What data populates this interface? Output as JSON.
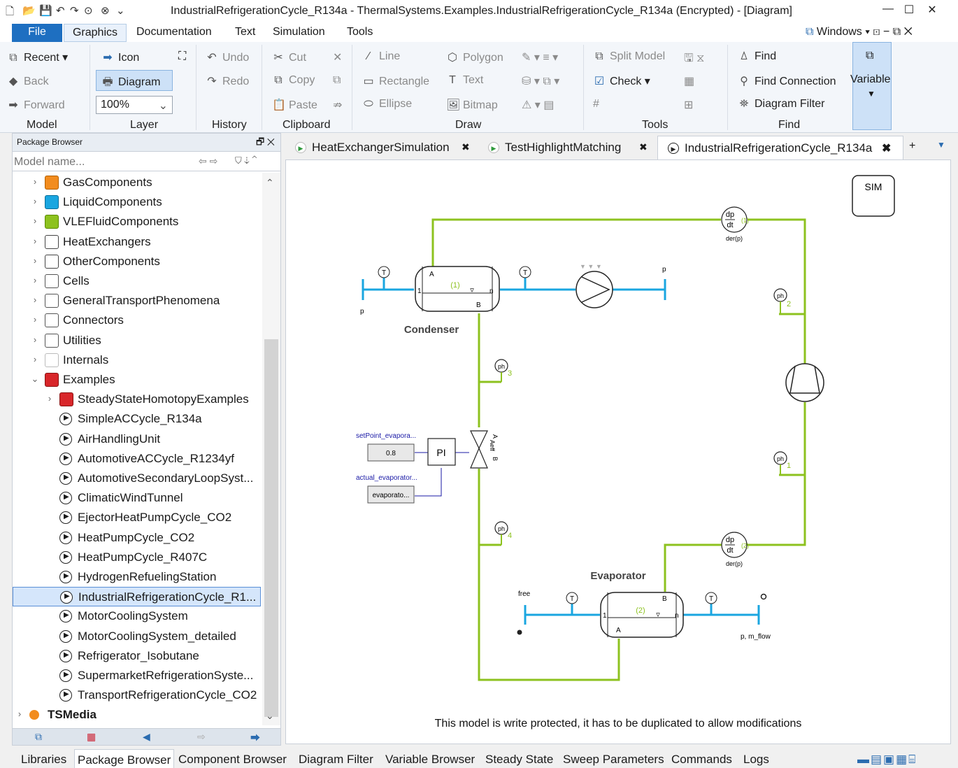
{
  "window": {
    "title": "IndustrialRefrigerationCycle_R134a - ThermalSystems.Examples.IndustrialRefrigerationCycle_R134a  (Encrypted) - [Diagram]",
    "windows_label": "Windows"
  },
  "menu": [
    "File",
    "Graphics",
    "Documentation",
    "Text",
    "Simulation",
    "Tools"
  ],
  "ribbon": {
    "model": {
      "recent": "Recent",
      "back": "Back",
      "forward": "Forward",
      "group": "Model"
    },
    "layer": {
      "icon": "Icon",
      "diagram": "Diagram",
      "zoom": "100%",
      "group": "Layer"
    },
    "history": {
      "undo": "Undo",
      "redo": "Redo",
      "group": "History"
    },
    "clipboard": {
      "cut": "Cut",
      "copy": "Copy",
      "paste": "Paste",
      "group": "Clipboard"
    },
    "draw": {
      "line": "Line",
      "rectangle": "Rectangle",
      "ellipse": "Ellipse",
      "polygon": "Polygon",
      "text": "Text",
      "bitmap": "Bitmap",
      "group": "Draw"
    },
    "tools": {
      "split_model": "Split Model",
      "check": "Check",
      "group": "Tools"
    },
    "find": {
      "find": "Find",
      "find_connection": "Find Connection",
      "diagram_filter": "Diagram Filter",
      "group": "Find"
    },
    "variables": "Variables"
  },
  "package_browser": {
    "title": "Package Browser",
    "search_placeholder": "Model name...",
    "items": [
      {
        "label": "GasComponents",
        "icon": "orange-package-icon",
        "level": 1,
        "expand": "›"
      },
      {
        "label": "LiquidComponents",
        "icon": "blue-package-icon",
        "level": 1,
        "expand": "›"
      },
      {
        "label": "VLEFluidComponents",
        "icon": "green-package-icon",
        "level": 1,
        "expand": "›"
      },
      {
        "label": "HeatExchangers",
        "icon": "heatexchanger-package-icon",
        "level": 1,
        "expand": "›"
      },
      {
        "label": "OtherComponents",
        "icon": "component-package-icon",
        "level": 1,
        "expand": "›"
      },
      {
        "label": "Cells",
        "icon": "package-icon",
        "level": 1,
        "expand": "›"
      },
      {
        "label": "GeneralTransportPhenomena",
        "icon": "package-icon",
        "level": 1,
        "expand": "›"
      },
      {
        "label": "Connectors",
        "icon": "package-icon",
        "level": 1,
        "expand": "›"
      },
      {
        "label": "Utilities",
        "icon": "package-icon",
        "level": 1,
        "expand": "›"
      },
      {
        "label": "Internals",
        "icon": "package-light-icon",
        "level": 1,
        "expand": "›"
      },
      {
        "label": "Examples",
        "icon": "examples-package-icon",
        "level": 1,
        "expand": "⌄"
      },
      {
        "label": "SteadyStateHomotopyExamples",
        "icon": "examples-package-icon",
        "level": 2,
        "expand": "›"
      },
      {
        "label": "SimpleACCycle_R134a",
        "icon": "play-icon",
        "level": 2,
        "expand": ""
      },
      {
        "label": "AirHandlingUnit",
        "icon": "play-icon",
        "level": 2,
        "expand": ""
      },
      {
        "label": "AutomotiveACCycle_R1234yf",
        "icon": "play-icon",
        "level": 2,
        "expand": ""
      },
      {
        "label": "AutomotiveSecondaryLoopSyst...",
        "icon": "play-icon",
        "level": 2,
        "expand": ""
      },
      {
        "label": "ClimaticWindTunnel",
        "icon": "play-icon",
        "level": 2,
        "expand": ""
      },
      {
        "label": "EjectorHeatPumpCycle_CO2",
        "icon": "play-icon",
        "level": 2,
        "expand": ""
      },
      {
        "label": "HeatPumpCycle_CO2",
        "icon": "play-icon",
        "level": 2,
        "expand": ""
      },
      {
        "label": "HeatPumpCycle_R407C",
        "icon": "play-icon",
        "level": 2,
        "expand": ""
      },
      {
        "label": "HydrogenRefuelingStation",
        "icon": "play-icon",
        "level": 2,
        "expand": ""
      },
      {
        "label": "IndustrialRefrigerationCycle_R1...",
        "icon": "play-icon",
        "level": 2,
        "expand": "",
        "selected": true
      },
      {
        "label": "MotorCoolingSystem",
        "icon": "play-icon",
        "level": 2,
        "expand": ""
      },
      {
        "label": "MotorCoolingSystem_detailed",
        "icon": "play-icon",
        "level": 2,
        "expand": ""
      },
      {
        "label": "Refrigerator_Isobutane",
        "icon": "play-icon",
        "level": 2,
        "expand": ""
      },
      {
        "label": "SupermarketRefrigerationSyste...",
        "icon": "play-icon",
        "level": 2,
        "expand": ""
      },
      {
        "label": "TransportRefrigerationCycle_CO2",
        "icon": "play-icon",
        "level": 2,
        "expand": ""
      },
      {
        "label": "TSMedia",
        "icon": "tsmedia-icon",
        "level": 0,
        "expand": "›",
        "bold": true
      }
    ]
  },
  "tabs": [
    {
      "label": "HeatExchangerSimulation",
      "active": false
    },
    {
      "label": "TestHighlightMatching",
      "active": false
    },
    {
      "label": "IndustrialRefrigerationCycle_R134a",
      "active": true
    }
  ],
  "diagram": {
    "sim_label": "SIM",
    "condenser_label": "Condenser",
    "evaporator_label": "Evaporator",
    "cond_level": "(1)",
    "evap_level": "(2)",
    "der1_idx": "(1)",
    "der2_idx": "(2)",
    "der_label": "der(p)",
    "ph_indices": [
      "2",
      "3",
      "1",
      "4"
    ],
    "pi_label": "PI",
    "setpoint_label": "setPoint_evapora...",
    "setpoint_value": "0.8",
    "actual_label": "actual_evaporator...",
    "actual_value": "evaporato...",
    "p_label": "p",
    "free_label": "free",
    "pmflow_label": "p, m_flow",
    "aeff_label": "Aeff",
    "port_a": "A",
    "port_b": "B",
    "port_1": "1",
    "port_n": "n",
    "write_protected_note": "This model is write protected, it has to be duplicated to allow modifications",
    "colors": {
      "refrigerant": "#8dc21f",
      "fluid": "#1aa6e0",
      "signal": "#1a1aa6"
    }
  },
  "bottom_tabs": [
    "Libraries",
    "Package Browser",
    "Component Browser",
    "Diagram Filter",
    "Variable Browser",
    "Steady State",
    "Sweep Parameters",
    "Commands",
    "Logs"
  ]
}
